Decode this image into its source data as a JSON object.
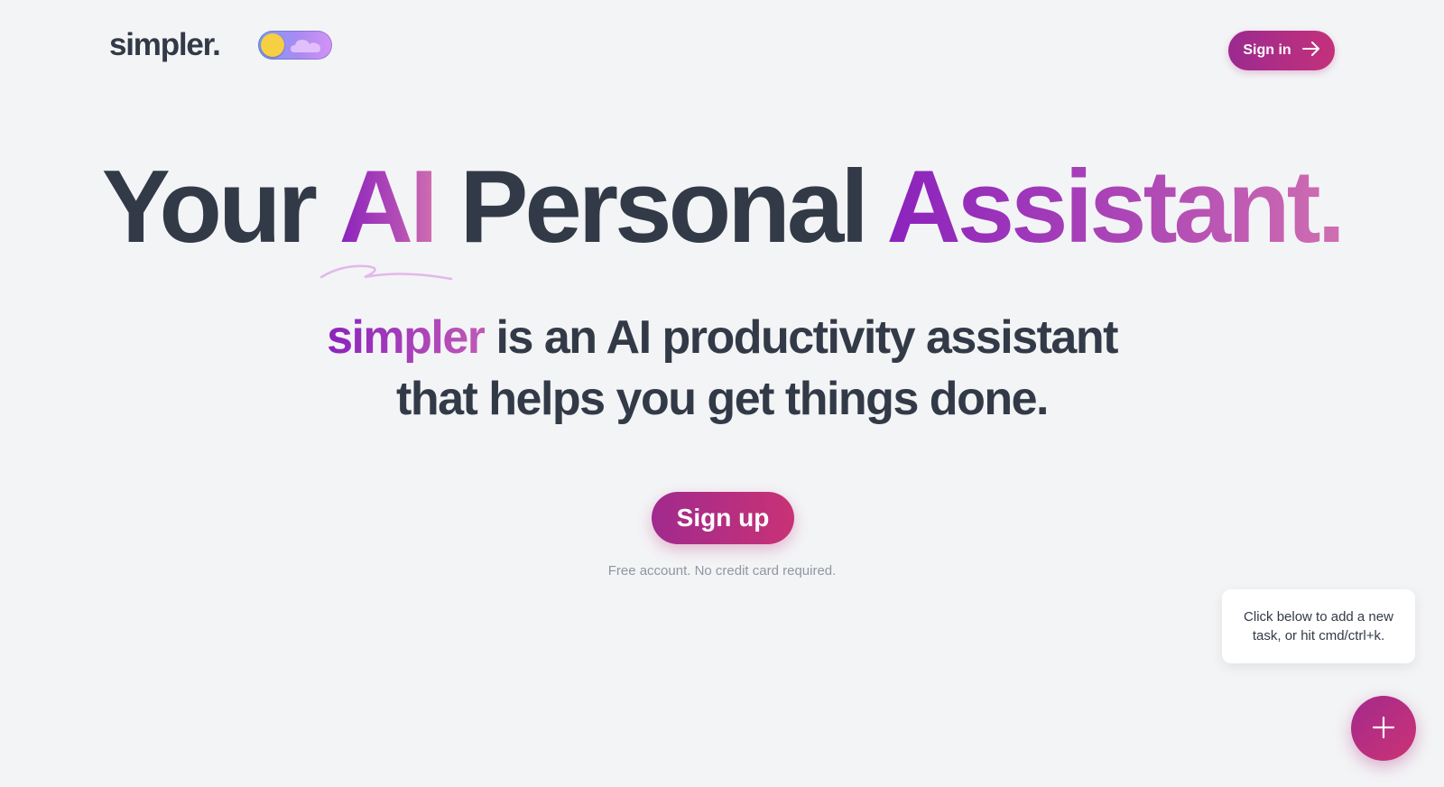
{
  "header": {
    "logo_text": "simpler.",
    "signin_label": "Sign in"
  },
  "hero": {
    "title_part1": "Your",
    "title_highlight1": "AI",
    "title_part2": "Personal",
    "title_highlight2": "Assistant.",
    "subtitle_brand": "simpler",
    "subtitle_line1_rest": "is an AI productivity assistant",
    "subtitle_line2": "that helps you get things done.",
    "signup_label": "Sign up",
    "fine_print": "Free account. No credit card required."
  },
  "tooltip": {
    "text": "Click below to add a new task, or hit cmd/ctrl+k."
  },
  "icons": {
    "toggle_sun": "sun-icon",
    "toggle_cloud": "cloud-icon",
    "signin_arrow": "arrow-right-icon",
    "fab": "plus-icon"
  },
  "colors": {
    "background": "#f3f4f6",
    "text_dark": "#333a47",
    "accent_purple": "#8b22bd",
    "accent_pink": "#c93275",
    "muted": "#9097a2"
  }
}
